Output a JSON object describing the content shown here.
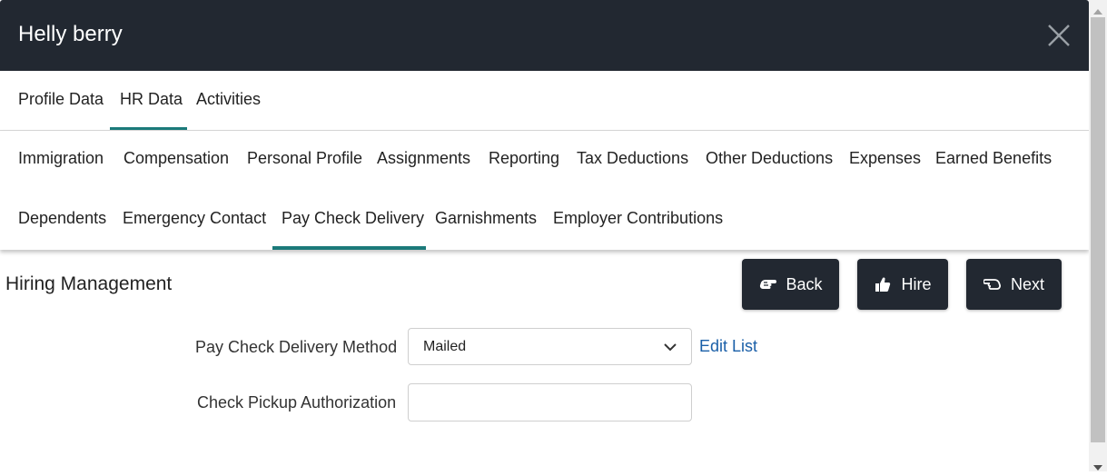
{
  "header": {
    "title": "Helly berry",
    "close_icon": "close-icon"
  },
  "tabs": [
    {
      "label": "Profile Data",
      "active": false
    },
    {
      "label": "HR Data",
      "active": true
    },
    {
      "label": "Activities",
      "active": false
    }
  ],
  "subtabs": [
    {
      "label": "Immigration"
    },
    {
      "label": "Compensation"
    },
    {
      "label": "Personal Profile"
    },
    {
      "label": "Assignments"
    },
    {
      "label": "Reporting"
    },
    {
      "label": "Tax Deductions"
    },
    {
      "label": "Other Deductions"
    },
    {
      "label": "Expenses"
    },
    {
      "label": "Earned Benefits"
    },
    {
      "label": "Dependents"
    },
    {
      "label": "Emergency Contact"
    },
    {
      "label": "Pay Check Delivery",
      "active": true
    },
    {
      "label": "Garnishments"
    },
    {
      "label": "Employer Contributions"
    }
  ],
  "section": {
    "title": "Hiring Management"
  },
  "actions": {
    "back_label": "Back",
    "hire_label": "Hire",
    "next_label": "Next"
  },
  "form": {
    "delivery_method": {
      "label": "Pay Check Delivery Method",
      "value": "Mailed",
      "edit_link": "Edit List"
    },
    "pickup_authorization": {
      "label": "Check Pickup Authorization",
      "value": ""
    }
  },
  "colors": {
    "header_bg": "#222831",
    "accent": "#1b7a7a",
    "link": "#1a5fa8"
  }
}
